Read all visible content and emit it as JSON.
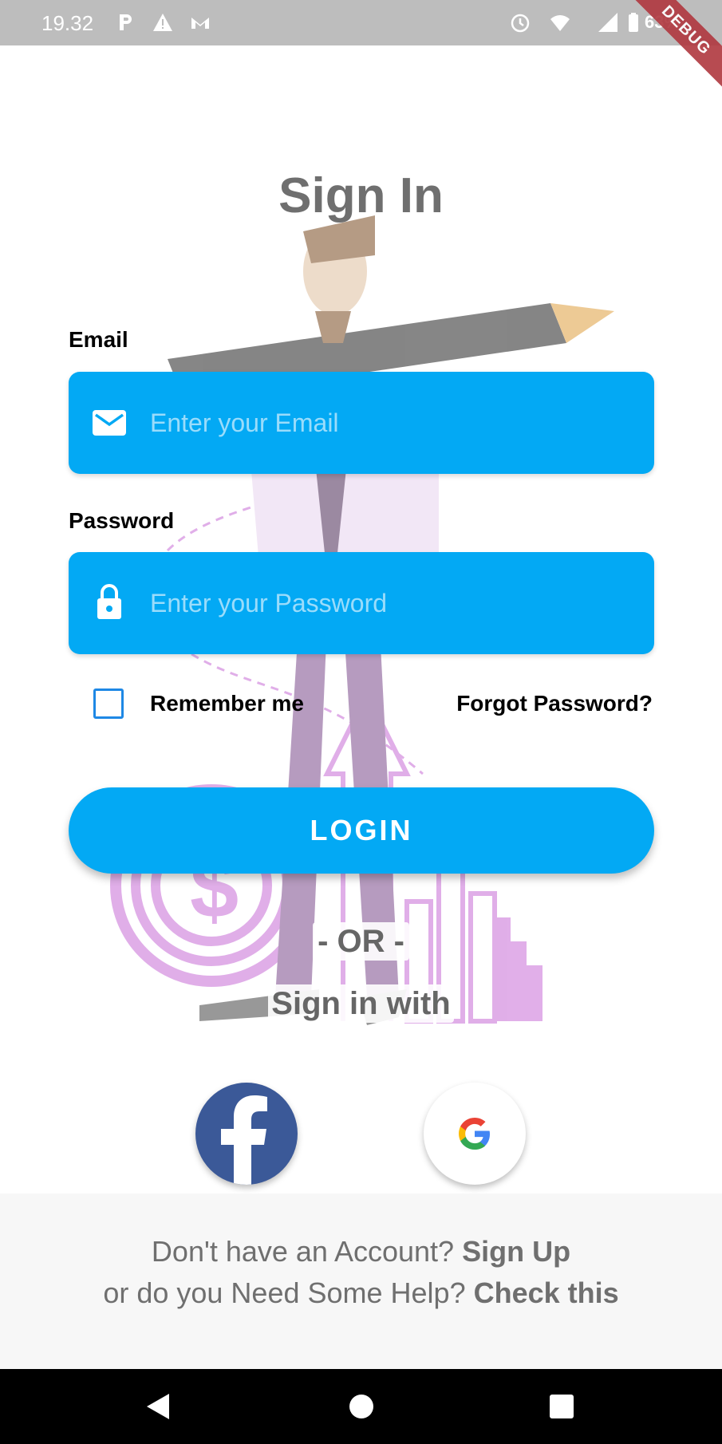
{
  "status_bar": {
    "time": "19.32",
    "battery": "63%"
  },
  "debug_banner": "DEBUG",
  "title": "Sign In",
  "email": {
    "label": "Email",
    "placeholder": "Enter your Email"
  },
  "password": {
    "label": "Password",
    "placeholder": "Enter your Password"
  },
  "remember_me": "Remember me",
  "forgot_password": "Forgot Password?",
  "login_button": "LOGIN",
  "or_text": "- OR -",
  "sign_in_with": "Sign in with",
  "footer": {
    "signup_prompt": "Don't have an Account? ",
    "signup_link": "Sign Up",
    "help_prompt": "or do you Need Some Help? ",
    "help_link": "Check this"
  },
  "colors": {
    "primary": "#03a9f4",
    "facebook": "#3b5998",
    "title_gray": "#6f6f6f"
  }
}
